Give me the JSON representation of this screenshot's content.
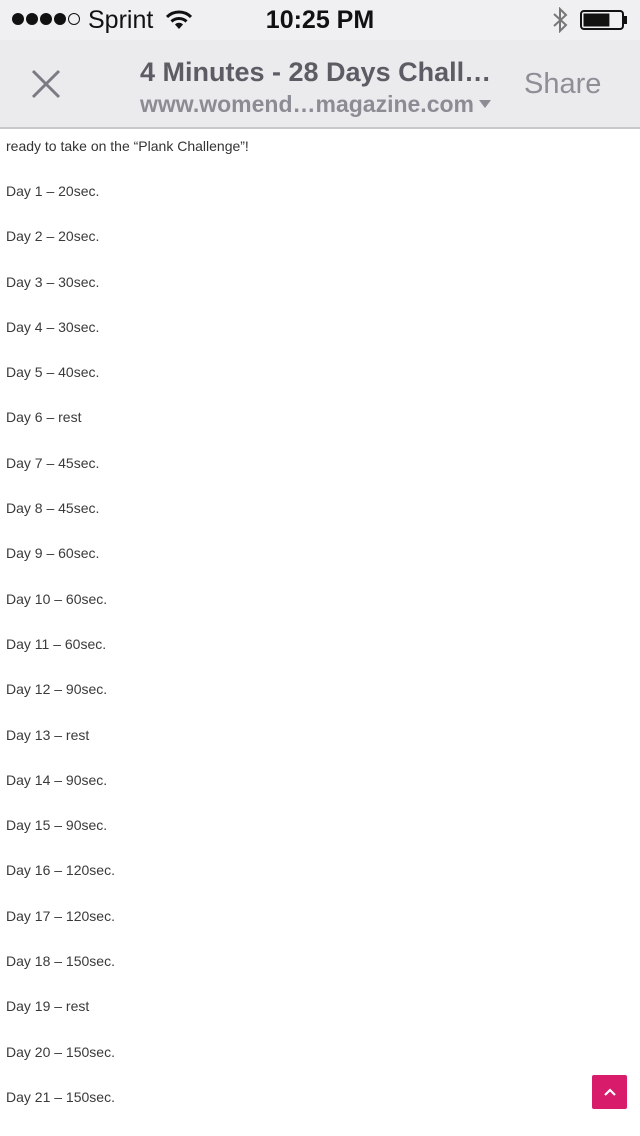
{
  "status_bar": {
    "carrier": "Sprint",
    "time": "10:25 PM",
    "signal_bars_filled": 4,
    "signal_bars_total": 5,
    "battery_level_percent": 70
  },
  "nav": {
    "title": "4 Minutes - 28 Days Chall…",
    "url": "www.womend…magazine.com",
    "share_label": "Share",
    "close_icon": "close-icon",
    "caret_icon": "chevron-down-icon"
  },
  "article": {
    "intro": "ready to take on the “Plank Challenge”!",
    "days": [
      "Day 1 – 20sec.",
      "Day 2 – 20sec.",
      "Day 3 – 30sec.",
      "Day 4 – 30sec.",
      "Day 5 – 40sec.",
      "Day 6 – rest",
      "Day 7 – 45sec.",
      "Day 8 – 45sec.",
      "Day 9 – 60sec.",
      "Day 10 – 60sec.",
      "Day 11 – 60sec.",
      "Day 12 – 90sec.",
      "Day 13 – rest",
      "Day 14 – 90sec.",
      "Day 15 – 90sec.",
      "Day 16 – 120sec.",
      "Day 17 – 120sec.",
      "Day 18 – 150sec.",
      "Day 19 – rest",
      "Day 20 – 150sec.",
      "Day 21 – 150sec."
    ]
  },
  "scroll_top_icon": "chevron-up-icon",
  "colors": {
    "accent": "#d81b6b",
    "nav_background": "#ebebee",
    "title_text": "#5c5c64",
    "url_text": "#8c8c94"
  }
}
